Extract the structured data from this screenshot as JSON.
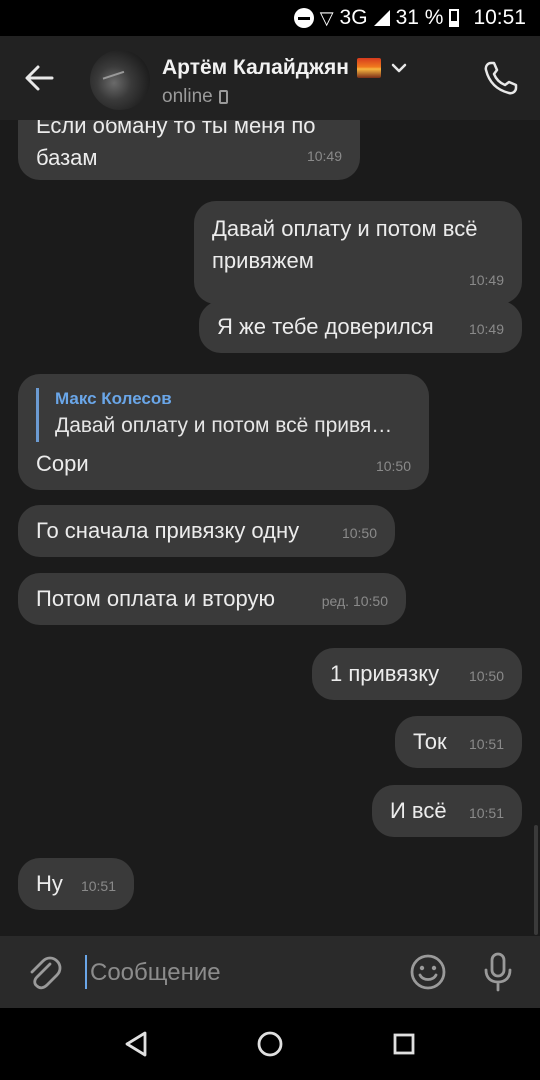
{
  "status_bar": {
    "network": "3G",
    "battery": "31 %",
    "time": "10:51"
  },
  "header": {
    "name": "Артём Калайджян",
    "status": "online"
  },
  "input": {
    "placeholder": "Сообщение"
  },
  "messages": [
    {
      "id": "m1",
      "side": "in",
      "text": "Если обману то ты меня по\nбазам",
      "time": "10:49"
    },
    {
      "id": "m2",
      "side": "out",
      "text": "Давай оплату и потом всё\nпривяжем",
      "time": "10:49"
    },
    {
      "id": "m3",
      "side": "out",
      "text": "Я же тебе доверился",
      "time": "10:49"
    },
    {
      "id": "m4",
      "side": "in",
      "reply_author": "Макс Колесов",
      "reply_text": "Давай оплату и потом всё привя…",
      "text": "Сори",
      "time": "10:50"
    },
    {
      "id": "m5",
      "side": "in",
      "text": "Го сначала привязку одну",
      "time": "10:50"
    },
    {
      "id": "m6",
      "side": "in",
      "text": "Потом оплата и вторую",
      "time": "ред. 10:50"
    },
    {
      "id": "m7",
      "side": "out",
      "text": "1 привязку",
      "time": "10:50"
    },
    {
      "id": "m8",
      "side": "out",
      "text": "Ток",
      "time": "10:51"
    },
    {
      "id": "m9",
      "side": "out",
      "text": "И всё",
      "time": "10:51"
    },
    {
      "id": "m10",
      "side": "in",
      "text": "Ну",
      "time": "10:51"
    }
  ],
  "colors": {
    "background": "#1b1b1b",
    "bubble": "#3a3a3a",
    "header": "#222222",
    "accent": "#6aa6e8"
  }
}
